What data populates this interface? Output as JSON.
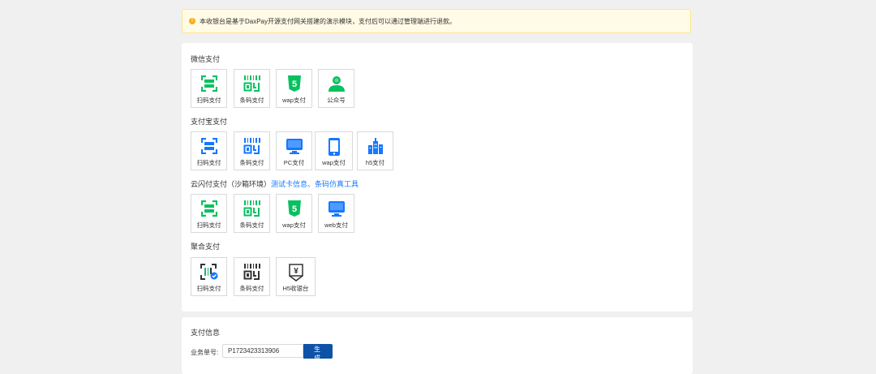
{
  "notice": {
    "text": "本收银台是基于DaxPay开源支付网关搭建的演示模块，支付后可以通过管理端进行退款。",
    "icon": "info-circle-icon"
  },
  "sections": {
    "wechat": {
      "title": "微信支付",
      "items": [
        "扫码支付",
        "条码支付",
        "wap支付",
        "公众号"
      ]
    },
    "alipay": {
      "title": "支付宝支付",
      "items": [
        "扫码支付",
        "条码支付",
        "PC支付",
        "wap支付",
        "h5支付"
      ]
    },
    "unionpay": {
      "title": "云闪付支付（沙箱环境）",
      "link": "测试卡信息、条码仿真工具",
      "items": [
        "扫码支付",
        "条码支付",
        "wap支付",
        "web支付"
      ]
    },
    "aggregate": {
      "title": "聚合支付",
      "items": [
        "扫码支付",
        "条码支付",
        "H5收银台"
      ]
    }
  },
  "pay_info": {
    "title": "支付信息",
    "order_label": "业务单号:",
    "order_value": "P1723423313906",
    "generate_label": "生 成"
  },
  "colors": {
    "wechat": "#07c160",
    "alipay": "#1677ff",
    "accent": "#0d52a7",
    "notice_bg": "#fffbe6"
  }
}
